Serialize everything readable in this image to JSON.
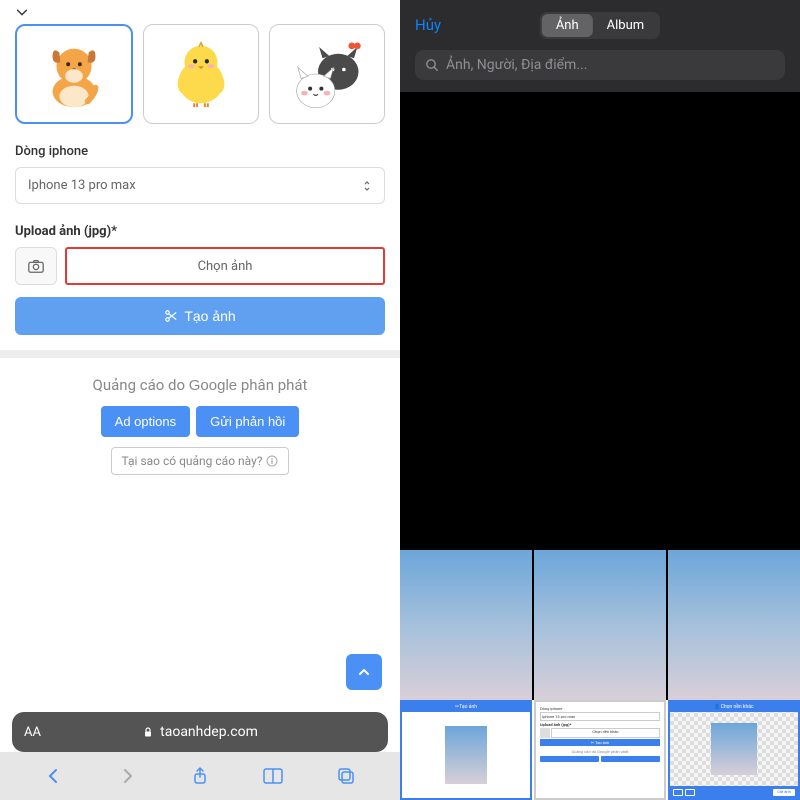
{
  "left": {
    "phone_label": "Dòng iphone",
    "phone_value": "Iphone 13 pro max",
    "upload_label": "Upload ảnh (jpg)*",
    "choose_button": "Chọn ảnh",
    "create_button": "Tạo ảnh",
    "ad_prefix": "Quảng cáo do ",
    "ad_google": "Google",
    "ad_suffix": " phân phát",
    "ad_options": "Ad options",
    "ad_feedback": "Gửi phản hồi",
    "why_ad": "Tại sao có quảng cáo này?",
    "url_text": "taoanhdep.com",
    "aa_label": "AA"
  },
  "right": {
    "cancel": "Hủy",
    "tab_photos": "Ảnh",
    "tab_albums": "Album",
    "search_placeholder": "Ảnh, Người, Địa điểm...",
    "thumb1_header": "Tạo ảnh",
    "thumb2_label1": "Dòng iphone",
    "thumb2_value1": "Iphone 13 pro max",
    "thumb2_label2": "Upload ảnh (jpg)*",
    "thumb2_choose": "Chọn nền khác",
    "thumb2_create": "Tạo ảnh",
    "thumb3_header": "Chọn nền khác",
    "thumb3_cut": "Cắt ảnh"
  }
}
